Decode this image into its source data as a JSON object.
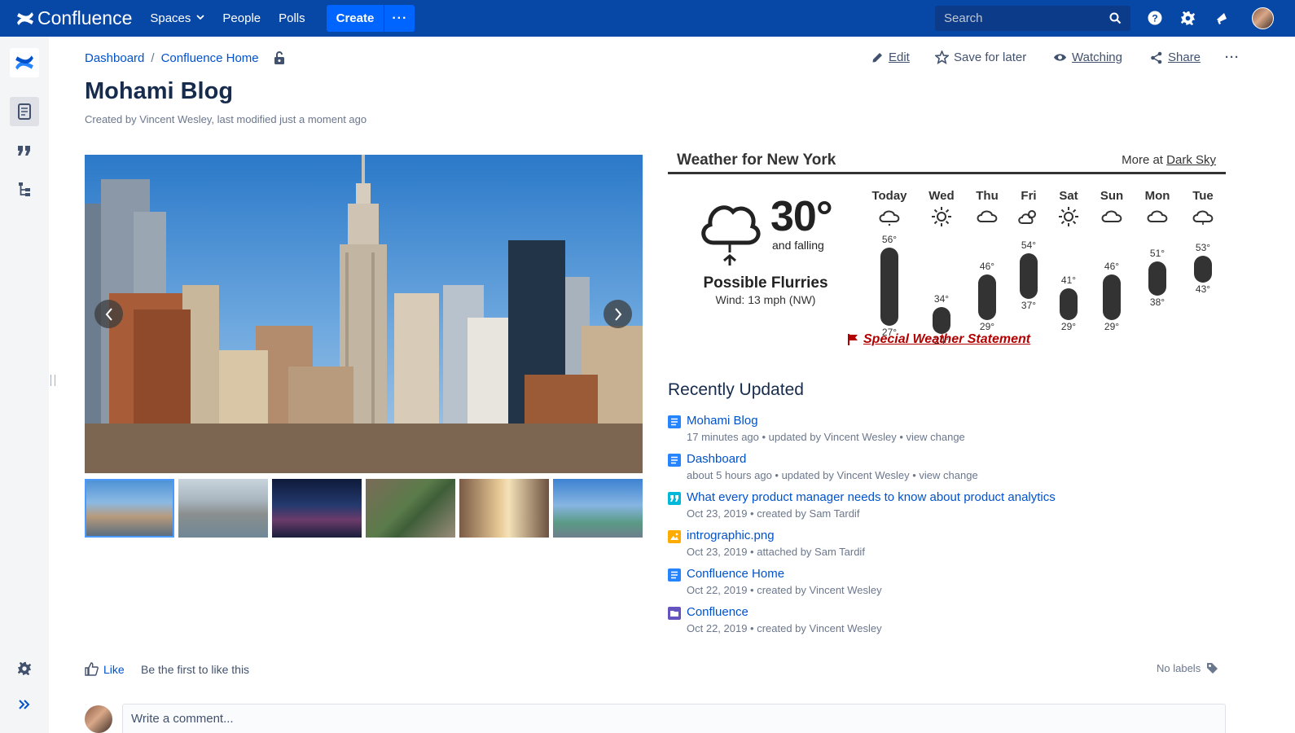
{
  "topnav": {
    "brand": "Confluence",
    "items": [
      {
        "label": "Spaces"
      },
      {
        "label": "People"
      },
      {
        "label": "Polls"
      }
    ],
    "create_label": "Create",
    "more_label": "···",
    "search_placeholder": "Search"
  },
  "breadcrumb": [
    "Dashboard",
    "Confluence Home"
  ],
  "actions": {
    "edit": "Edit",
    "save": "Save for later",
    "watching": "Watching",
    "share": "Share",
    "more": "···"
  },
  "page": {
    "title": "Mohami Blog",
    "byline": "Created by Vincent Wesley, last modified just a moment ago"
  },
  "weather": {
    "title": "Weather for New York",
    "more_prefix": "More at ",
    "more_link": "Dark Sky",
    "temp": "30°",
    "trend": "and falling",
    "summary": "Possible Flurries",
    "wind": "Wind: 13 mph (NW)",
    "alert": "Special Weather Statement",
    "days": [
      {
        "name": "Today",
        "icon": "cloud-snow-icon",
        "hi": "56°",
        "lo": "27°",
        "hi_val": 56,
        "lo_val": 27
      },
      {
        "name": "Wed",
        "icon": "sun-icon",
        "hi": "34°",
        "lo": "24°",
        "hi_val": 34,
        "lo_val": 24
      },
      {
        "name": "Thu",
        "icon": "cloud-icon",
        "hi": "46°",
        "lo": "29°",
        "hi_val": 46,
        "lo_val": 29
      },
      {
        "name": "Fri",
        "icon": "partly-cloudy-icon",
        "hi": "54°",
        "lo": "37°",
        "hi_val": 54,
        "lo_val": 37
      },
      {
        "name": "Sat",
        "icon": "sun-icon",
        "hi": "41°",
        "lo": "29°",
        "hi_val": 41,
        "lo_val": 29
      },
      {
        "name": "Sun",
        "icon": "cloud-icon",
        "hi": "46°",
        "lo": "29°",
        "hi_val": 46,
        "lo_val": 29
      },
      {
        "name": "Mon",
        "icon": "cloud-icon",
        "hi": "51°",
        "lo": "38°",
        "hi_val": 51,
        "lo_val": 38
      },
      {
        "name": "Tue",
        "icon": "cloud-rain-icon",
        "hi": "53°",
        "lo": "43°",
        "hi_val": 53,
        "lo_val": 43
      }
    ]
  },
  "recent": {
    "title": "Recently Updated",
    "items": [
      {
        "title": "Mohami Blog",
        "meta": "17 minutes ago • updated by Vincent Wesley • view change",
        "icon": "page-icon",
        "color": "#2684ff"
      },
      {
        "title": "Dashboard",
        "meta": "about 5 hours ago • updated by Vincent Wesley • view change",
        "icon": "page-icon",
        "color": "#2684ff"
      },
      {
        "title": "What every product manager needs to know about product analytics",
        "meta": "Oct 23, 2019 • created by Sam Tardif",
        "icon": "blog-quote-icon",
        "color": "#00b8d9"
      },
      {
        "title": "intrographic.png",
        "meta": "Oct 23, 2019 • attached by Sam Tardif",
        "icon": "image-file-icon",
        "color": "#ffab00"
      },
      {
        "title": "Confluence Home",
        "meta": "Oct 22, 2019 • created by Vincent Wesley",
        "icon": "page-icon",
        "color": "#2684ff"
      },
      {
        "title": "Confluence",
        "meta": "Oct 22, 2019 • created by Vincent Wesley",
        "icon": "space-icon",
        "color": "#6554c0"
      }
    ]
  },
  "footer": {
    "like": "Like",
    "like_text": "Be the first to like this",
    "labels": "No labels",
    "comment_placeholder": "Write a comment..."
  },
  "colors": {
    "nav": "#0747a6",
    "create": "#0065ff",
    "link": "#0052cc",
    "alert": "#b20000"
  }
}
